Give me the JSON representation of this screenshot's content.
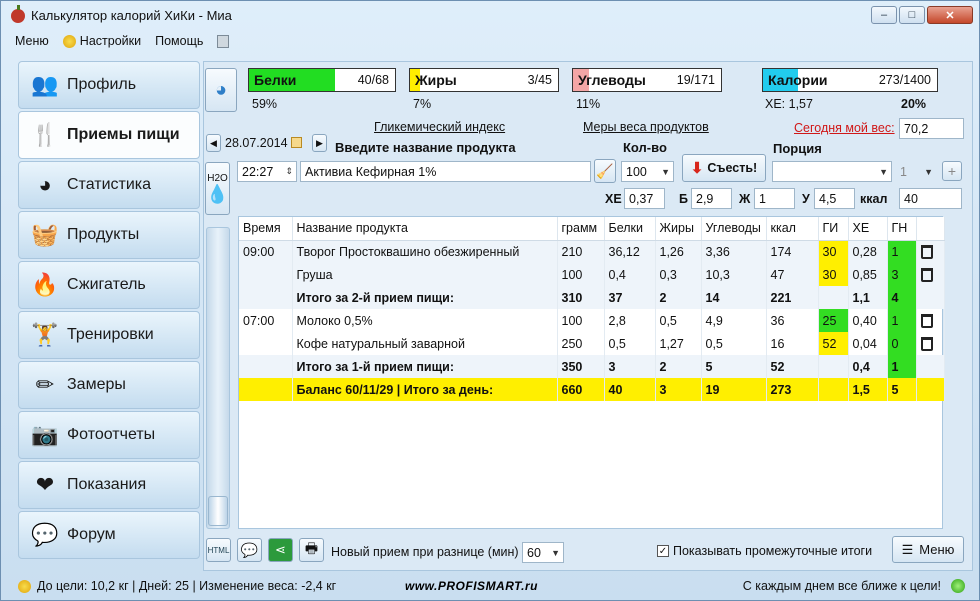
{
  "window": {
    "title": "Калькулятор калорий ХиКи - Миа",
    "min": "–",
    "max": "□",
    "close": "✕"
  },
  "menu": {
    "menu": "Меню",
    "settings": "Настройки",
    "help": "Помощь"
  },
  "sidebar": [
    {
      "label": "Профиль",
      "icon": "profile-icon",
      "glyph": "👥"
    },
    {
      "label": "Приемы пищи",
      "icon": "fork-knife-icon",
      "glyph": "🍴"
    },
    {
      "label": "Статистика",
      "icon": "pie-chart-icon",
      "glyph": "◕"
    },
    {
      "label": "Продукты",
      "icon": "basket-icon",
      "glyph": "🧺"
    },
    {
      "label": "Сжигатель",
      "icon": "flame-icon",
      "glyph": "🔥"
    },
    {
      "label": "Тренировки",
      "icon": "dumbbell-icon",
      "glyph": "🏋"
    },
    {
      "label": "Замеры",
      "icon": "pencil-icon",
      "glyph": "✏"
    },
    {
      "label": "Фотоотчеты",
      "icon": "camera-icon",
      "glyph": "📷"
    },
    {
      "label": "Показания",
      "icon": "heart-pulse-icon",
      "glyph": "❤"
    },
    {
      "label": "Форум",
      "icon": "chat-bubbles-icon",
      "glyph": "💬"
    }
  ],
  "macros": {
    "protein": {
      "label": "Белки",
      "value": "40/68",
      "pct": "59%",
      "fill": 0.59,
      "color": "#22dd22"
    },
    "fat": {
      "label": "Жиры",
      "value": "3/45",
      "pct": "7%",
      "fill": 0.07,
      "color": "#ffee00"
    },
    "carbs": {
      "label": "Углеводы",
      "value": "19/171",
      "pct": "11%",
      "fill": 0.11,
      "color": "#f4a6a6"
    },
    "calories": {
      "label": "Калории",
      "value": "273/1400",
      "pct": "20%",
      "fill": 0.2,
      "color": "#22ccee"
    },
    "xe": "ХЕ: 1,57"
  },
  "links": {
    "gi": "Гликемический индекс",
    "measures": "Меры веса продуктов",
    "weight_today": "Сегодня мой вес:",
    "weight_value": "70,2"
  },
  "entry": {
    "date": "28.07.2014",
    "name_label": "Введите название продукта",
    "qty_label": "Кол-во",
    "portion_label": "Порция",
    "time": "22:27",
    "product": "Активиа Кефирная 1%",
    "qty": "100",
    "eat_button": "Съесть!",
    "portion_count": "1",
    "h2o": "H2O",
    "xe_label": "ХЕ",
    "xe": "0,37",
    "b_label": "Б",
    "b": "2,9",
    "zh_label": "Ж",
    "zh": "1",
    "u_label": "У",
    "u": "4,5",
    "kcal_label": "ккал",
    "kcal": "40"
  },
  "table": {
    "headers": [
      "Время",
      "Название продукта",
      "грамм",
      "Белки",
      "Жиры",
      "Углеводы",
      "ккал",
      "ГИ",
      "ХЕ",
      "ГН",
      ""
    ],
    "rows": [
      {
        "type": "item",
        "time": "09:00",
        "name": "Творог Простоквашино обезжиренный",
        "g": "210",
        "b": "36,12",
        "zh": "1,26",
        "u": "3,36",
        "kcal": "174",
        "gi": "30",
        "gi_c": "y",
        "xe": "0,28",
        "gn": "1",
        "gn_c": "g"
      },
      {
        "type": "item",
        "time": "",
        "name": "Груша",
        "g": "100",
        "b": "0,4",
        "zh": "0,3",
        "u": "10,3",
        "kcal": "47",
        "gi": "30",
        "gi_c": "y",
        "xe": "0,85",
        "gn": "3",
        "gn_c": "g"
      },
      {
        "type": "sum",
        "time": "",
        "name": "Итого за 2-й прием пищи:",
        "g": "310",
        "b": "37",
        "zh": "2",
        "u": "14",
        "kcal": "221",
        "gi": "",
        "gi_c": "",
        "xe": "1,1",
        "gn": "4",
        "gn_c": "g"
      },
      {
        "type": "item",
        "time": "07:00",
        "name": "Молоко 0,5%",
        "g": "100",
        "b": "2,8",
        "zh": "0,5",
        "u": "4,9",
        "kcal": "36",
        "gi": "25",
        "gi_c": "g",
        "xe": "0,40",
        "gn": "1",
        "gn_c": "g"
      },
      {
        "type": "item",
        "time": "",
        "name": "Кофе натуральный заварной",
        "g": "250",
        "b": "0,5",
        "zh": "1,27",
        "u": "0,5",
        "kcal": "16",
        "gi": "52",
        "gi_c": "y",
        "xe": "0,04",
        "gn": "0",
        "gn_c": "g"
      },
      {
        "type": "sum",
        "time": "",
        "name": "Итого за 1-й прием пищи:",
        "g": "350",
        "b": "3",
        "zh": "2",
        "u": "5",
        "kcal": "52",
        "gi": "",
        "gi_c": "",
        "xe": "0,4",
        "gn": "1",
        "gn_c": "g"
      },
      {
        "type": "bal",
        "time": "",
        "name": "Баланс 60/11/29  |  Итого за день:",
        "g": "660",
        "b": "40",
        "zh": "3",
        "u": "19",
        "kcal": "273",
        "gi": "",
        "gi_c": "",
        "xe": "1,5",
        "gn": "5",
        "gn_c": ""
      }
    ]
  },
  "bottom": {
    "interval_label": "Новый прием при разнице (мин)",
    "interval": "60",
    "show_totals": "Показывать промежуточные итоги",
    "menu_button": "Меню"
  },
  "status": {
    "left": "До цели: 10,2 кг | Дней: 25 | Изменение веса: -2,4 кг",
    "watermark": "www.PROFISMART.ru",
    "right": "С каждым днем все ближе к цели!"
  }
}
